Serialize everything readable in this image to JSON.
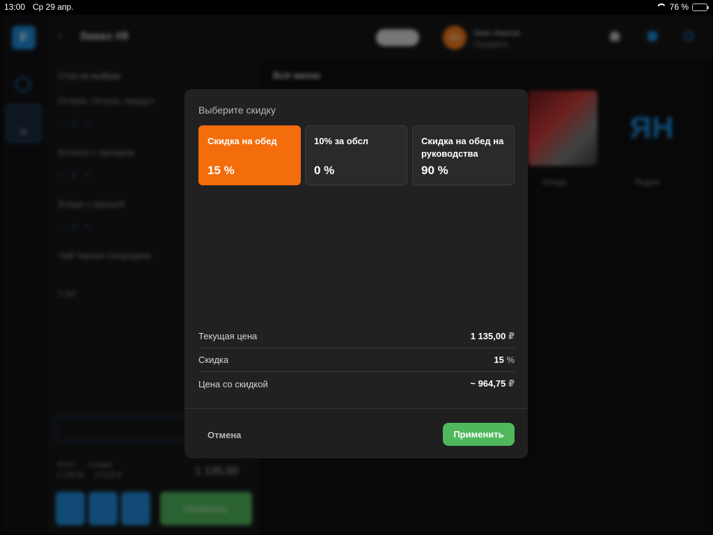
{
  "status_bar": {
    "time": "13:00",
    "date": "Ср 29 апр.",
    "battery": "76 %"
  },
  "background": {
    "title": "Заказ #8",
    "user_initials": "ИИ",
    "user_name": "Иван Иванов",
    "user_role": "Продавец",
    "table_label": "Стол не выбран",
    "order_lines": [
      "Острое, Острое, продукт",
      "Котлета с гарниром",
      "Блюдо с курицей",
      "Чай Черная Смородина",
      "1 шт"
    ],
    "menu_header": "Всё меню",
    "tiles": [
      {
        "caption": "Блюдо"
      },
      {
        "caption": "Яндекс",
        "logo_text": "ЯН"
      }
    ],
    "totals": {
      "label_a": "Итого",
      "value_a": "1 135,00",
      "label_b": "Скидка",
      "value_b": "170,25 ₽"
    },
    "big_total": "1 135,00",
    "pay_label": "Оплатить"
  },
  "modal": {
    "title": "Выберите скидку",
    "discounts": [
      {
        "name": "Скидка на обед",
        "value": "15 %",
        "selected": true
      },
      {
        "name": "10% за обсл",
        "value": "0 %",
        "selected": false
      },
      {
        "name": "Скидка на обед на руководства",
        "value": "90 %",
        "selected": false
      }
    ],
    "summary": {
      "current_price_label": "Текущая цена",
      "current_price_value": "1 135,00",
      "current_price_unit": "₽",
      "discount_label": "Скидка",
      "discount_value": "15",
      "discount_unit": "%",
      "final_price_label": "Цена со скидкой",
      "final_price_value": "~ 964,75",
      "final_price_unit": "₽"
    },
    "cancel_label": "Отмена",
    "apply_label": "Применить"
  },
  "colors": {
    "accent_orange": "#f36d0c",
    "apply_green": "#4fb85c",
    "brand_blue": "#1e88d6"
  }
}
